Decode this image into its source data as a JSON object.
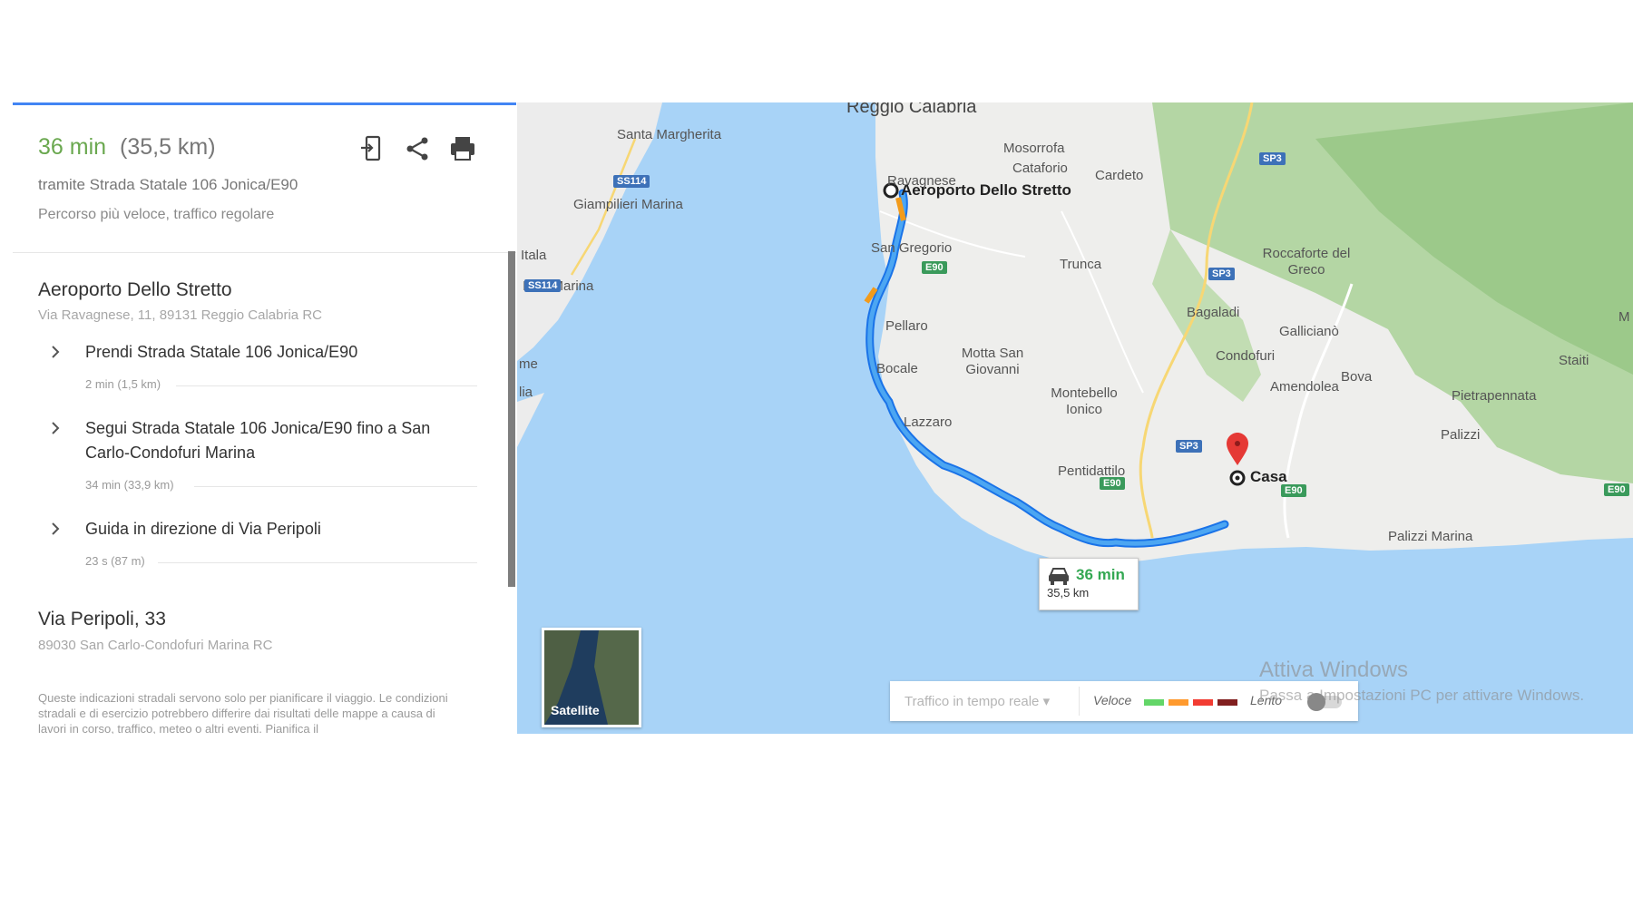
{
  "summary": {
    "duration": "36 min",
    "distance": "(35,5 km)",
    "via": "tramite Strada Statale 106 Jonica/E90",
    "note": "Percorso più veloce, traffico regolare",
    "tools": [
      "send-to-device-icon",
      "share-icon",
      "print-icon"
    ]
  },
  "origin": {
    "title": "Aeroporto Dello Stretto",
    "address": "Via Ravagnese, 11, 89131 Reggio Calabria RC"
  },
  "steps": [
    {
      "text": "Prendi Strada Statale 106 Jonica/E90",
      "meta": "2 min (1,5 km)"
    },
    {
      "text": "Segui Strada Statale 106 Jonica/E90 fino a San Carlo-Condofuri Marina",
      "meta": "34 min (33,9 km)"
    },
    {
      "text": "Guida in direzione di Via Peripoli",
      "meta": "23 s (87 m)"
    }
  ],
  "destination": {
    "title": "Via Peripoli, 33",
    "address": "89030 San Carlo-Condofuri Marina RC"
  },
  "disclaimer": "Queste indicazioni stradali servono solo per pianificare il viaggio. Le condizioni stradali e di esercizio potrebbero differire dai risultati delle mappe a causa di lavori in corso, traffico, meteo o altri eventi. Pianifica il",
  "map": {
    "places": [
      "Reggio Calabria",
      "Santa Margherita",
      "Giampilieri Marina",
      "Itala",
      "Itala Marina",
      "me",
      "lia",
      "Mosorrofa",
      "Cataforio",
      "Cardeto",
      "Ravagnese",
      "San Gregorio",
      "Trunca",
      "Pellaro",
      "Motta San Giovanni",
      "Bocale",
      "Bagaladi",
      "Condofuri",
      "Roccaforte del Greco",
      "Gallicianò",
      "Amendolea",
      "Bova",
      "Staiti",
      "Pietrapennata",
      "Montebello Ionico",
      "Lazzaro",
      "Palizzi",
      "Pentidattilo",
      "Palizzi Marina",
      "M"
    ],
    "origin_label": "Aeroporto Dello Stretto",
    "destination_label": "Casa",
    "shields": [
      "SS114",
      "SS114",
      "SP3",
      "SP3",
      "SP3",
      "E90",
      "E90",
      "E90",
      "E90"
    ],
    "route_card": {
      "time": "36 min",
      "distance": "35,5 km"
    },
    "satellite_label": "Satellite",
    "traffic": {
      "select_label": "Traffico in tempo reale",
      "fast_label": "Veloce",
      "slow_label": "Lento",
      "colors": [
        "#63d668",
        "#ff9a2e",
        "#f23c32",
        "#811f1f"
      ]
    },
    "watermark": {
      "line1": "Attiva Windows",
      "line2": "Passa a Impostazioni PC per attivare Windows."
    }
  }
}
